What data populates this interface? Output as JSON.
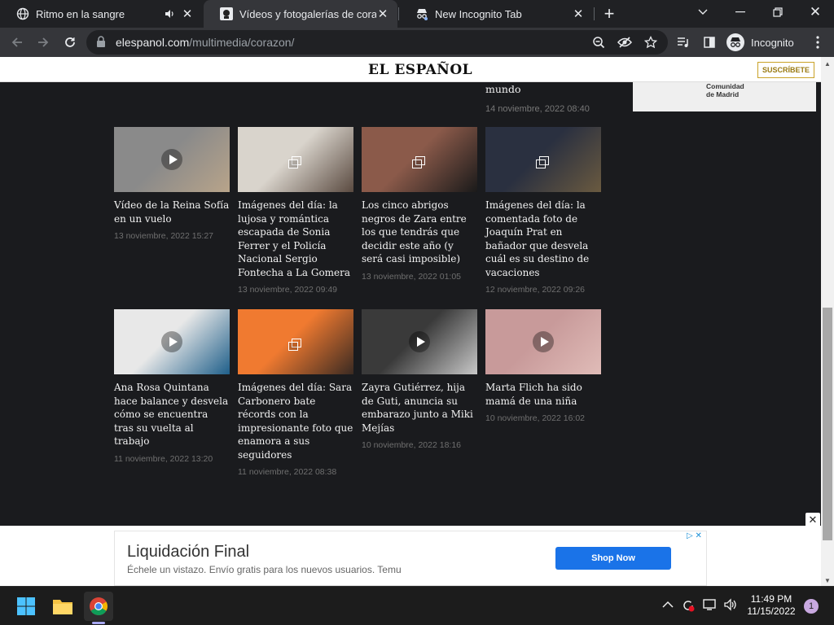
{
  "browser": {
    "tabs": [
      {
        "title": "Ritmo en la sangre",
        "audio_icon": "speaker-icon"
      },
      {
        "title": "Vídeos y fotogalerías de corazon",
        "active": true
      },
      {
        "title": "New Incognito Tab"
      }
    ],
    "new_tab_label": "+",
    "url_domain": "elespanol.com",
    "url_path": "/multimedia/corazon/",
    "profile_label": "Incognito"
  },
  "site": {
    "logo_text": "EL ESPAÑOL",
    "subscribe_label": "SUSCRÍBETE"
  },
  "previous_article": {
    "title_fragment": "mundo",
    "date": "14 noviembre, 2022 08:40"
  },
  "top_ad": {
    "text_line1": "Comunidad",
    "text_line2": "de Madrid"
  },
  "articles": [
    {
      "title": "Vídeo de la Reina Sofía en un vuelo",
      "date": "13 noviembre, 2022 15:27",
      "media": "video",
      "thumb_colors": [
        "#8a8a8a",
        "#b8a48a"
      ]
    },
    {
      "title": "Imágenes del día: la lujosa y romántica escapada de Sonia Ferrer y el Policía Nacional Sergio Fontecha a La Gomera",
      "date": "13 noviembre, 2022 09:49",
      "media": "gallery",
      "thumb_colors": [
        "#d9d4cc",
        "#5a4a40"
      ]
    },
    {
      "title": "Los cinco abrigos negros de Zara entre los que tendrás que decidir este año (y será casi imposible)",
      "date": "13 noviembre, 2022 01:05",
      "media": "gallery",
      "thumb_colors": [
        "#8b5a4a",
        "#1a1a1a"
      ]
    },
    {
      "title": "Imágenes del día: la comentada foto de Joaquín Prat en bañador que desvela cuál es su destino de vacaciones",
      "date": "12 noviembre, 2022 09:26",
      "media": "gallery",
      "thumb_colors": [
        "#2a3040",
        "#6a5a40"
      ]
    },
    {
      "title": "Ana Rosa Quintana hace balance y desvela cómo se encuentra tras su vuelta al trabajo",
      "date": "11 noviembre, 2022 13:20",
      "media": "video",
      "thumb_colors": [
        "#e8e8e8",
        "#1f5f8a"
      ]
    },
    {
      "title": "Imágenes del día: Sara Carbonero bate récords con la impresionante foto que enamora a sus seguidores",
      "date": "11 noviembre, 2022 08:38",
      "media": "gallery",
      "thumb_colors": [
        "#f07a30",
        "#3a2a22"
      ]
    },
    {
      "title": "Zayra Gutiérrez, hija de Guti, anuncia su embarazo junto a Miki Mejías",
      "date": "10 noviembre, 2022 18:16",
      "media": "video",
      "thumb_colors": [
        "#3a3a3a",
        "#c8c8c8"
      ]
    },
    {
      "title": "Marta Flich ha sido mamá de una niña",
      "date": "10 noviembre, 2022 16:02",
      "media": "video",
      "thumb_colors": [
        "#c89a9a",
        "#e0bcb8"
      ]
    }
  ],
  "bottom_ad": {
    "title": "Liquidación Final",
    "description": "Échele un vistazo. Envío gratis para los nuevos usuarios. Temu",
    "button_label": "Shop Now"
  },
  "taskbar": {
    "time": "11:49 PM",
    "date": "11/15/2022",
    "notification_count": "1"
  }
}
